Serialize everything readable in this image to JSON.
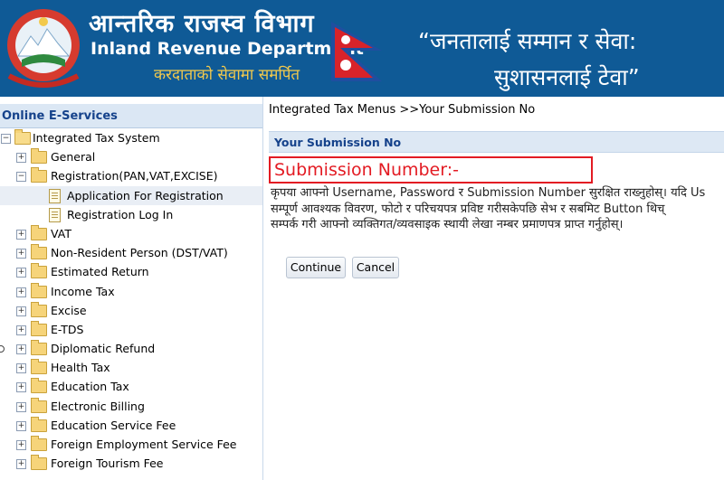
{
  "header": {
    "title_np": "आन्तरिक राजस्व विभाग",
    "title_en": "Inland Revenue Department",
    "tagline_np": "करदाताको सेवामा समर्पित",
    "slogan_line1": "“जनतालाई सम्मान र सेवा:",
    "slogan_line2": "सुशासनलाई टेवा”",
    "emblem_icon": "nepal-emblem-icon",
    "flag_icon": "nepal-flag-icon",
    "background_color": "#0f5a96"
  },
  "sidebar": {
    "heading": "Online E-Services",
    "root": "Integrated Tax System",
    "items": [
      {
        "label": "General",
        "level": 1,
        "icon": "folder-icon",
        "expander": "+"
      },
      {
        "label": "Registration(PAN,VAT,EXCISE)",
        "level": 1,
        "icon": "folder-open-icon",
        "expander": "-"
      },
      {
        "label": "Application For Registration",
        "level": 2,
        "icon": "document-icon",
        "selected": true
      },
      {
        "label": "Registration Log In",
        "level": 2,
        "icon": "document-icon"
      },
      {
        "label": "VAT",
        "level": 1,
        "icon": "folder-icon",
        "expander": "+"
      },
      {
        "label": "Non-Resident Person (DST/VAT)",
        "level": 1,
        "icon": "folder-icon",
        "expander": "+"
      },
      {
        "label": "Estimated Return",
        "level": 1,
        "icon": "folder-icon",
        "expander": "+"
      },
      {
        "label": "Income Tax",
        "level": 1,
        "icon": "folder-icon",
        "expander": "+"
      },
      {
        "label": "Excise",
        "level": 1,
        "icon": "folder-icon",
        "expander": "+"
      },
      {
        "label": "E-TDS",
        "level": 1,
        "icon": "folder-icon",
        "expander": "+"
      },
      {
        "label": "Diplomatic Refund",
        "level": 1,
        "icon": "folder-icon",
        "expander": "+"
      },
      {
        "label": "Health Tax",
        "level": 1,
        "icon": "folder-icon",
        "expander": "+"
      },
      {
        "label": "Education Tax",
        "level": 1,
        "icon": "folder-icon",
        "expander": "+"
      },
      {
        "label": "Electronic Billing",
        "level": 1,
        "icon": "folder-icon",
        "expander": "+"
      },
      {
        "label": "Education Service Fee",
        "level": 1,
        "icon": "folder-icon",
        "expander": "+"
      },
      {
        "label": "Foreign Employment Service Fee",
        "level": 1,
        "icon": "folder-icon",
        "expander": "+"
      },
      {
        "label": "Foreign Tourism Fee",
        "level": 1,
        "icon": "folder-icon",
        "expander": "+"
      }
    ]
  },
  "main": {
    "breadcrumb": "Integrated Tax Menus >>Your Submission No",
    "panel_title": "Your Submission No",
    "submission_label": "Submission Number:-",
    "info_lines": [
      "कृपया आफ्नो Username, Password र Submission Number सुरक्षित राख्नुहोस्। यदि Us",
      "सम्पूर्ण आवश्यक विवरण, फोटो र परिचयपत्र प्रविष्ट गरीसकेपछि सेभ र सबमिट Button थिच्",
      "सम्पर्क गरी आफ्नो व्यक्तिगत/व्यवसाइक स्थायी लेखा नम्बर प्रमाणपत्र प्राप्त गर्नुहोस्।"
    ],
    "continue_label": "Continue",
    "cancel_label": "Cancel",
    "accent_color": "#e31b23"
  }
}
